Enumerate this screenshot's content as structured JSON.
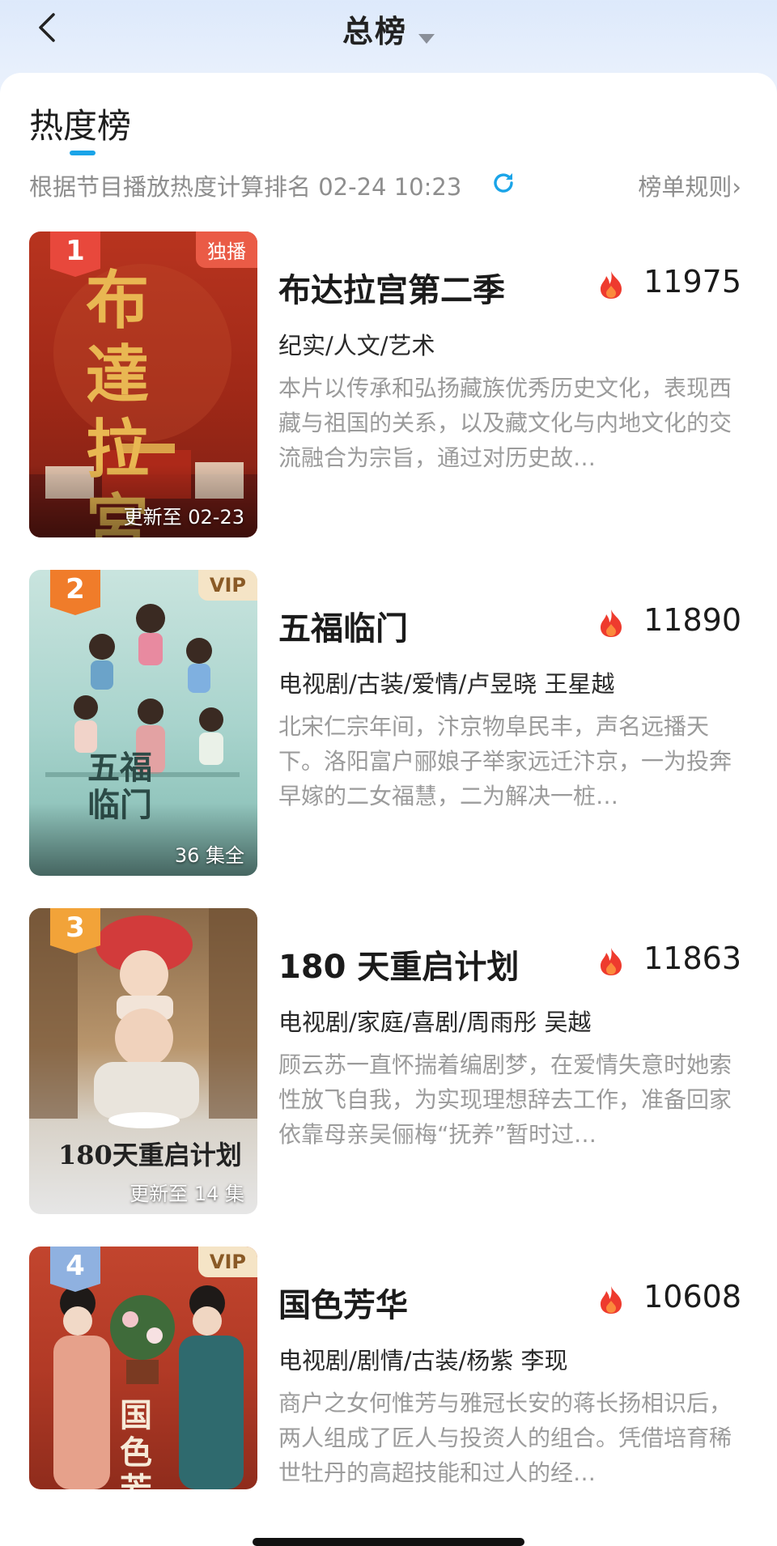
{
  "header": {
    "title": "总榜"
  },
  "section": {
    "title": "热度榜",
    "subtitle": "根据节目播放热度计算排名 02-24 10:23",
    "rules_link": "榜单规则›"
  },
  "items": [
    {
      "rank": "1",
      "corner_tag": "独播",
      "update": "更新至 02-23",
      "title": "布达拉宫第二季",
      "heat": "11975",
      "genres": "纪实/人文/艺术",
      "desc": "本片以传承和弘扬藏族优秀历史文化，表现西藏与祖国的关系，以及藏文化与内地文化的交流融合为宗旨，通过对历史故…",
      "poster_art": "布達拉宮",
      "rank_color": "#e8483c"
    },
    {
      "rank": "2",
      "corner_tag": "VIP",
      "update": "36 集全",
      "title": "五福临门",
      "heat": "11890",
      "genres": "电视剧/古装/爱情/卢昱晓 王星越",
      "desc": "北宋仁宗年间，汴京物阜民丰，声名远播天下。洛阳富户郦娘子举家远迁汴京，一为投奔早嫁的二女福慧，二为解决一桩…",
      "poster_art": "五福临门",
      "rank_color": "#f07c2a"
    },
    {
      "rank": "3",
      "corner_tag": "",
      "update": "更新至 14 集",
      "title": "180 天重启计划",
      "heat": "11863",
      "genres": "电视剧/家庭/喜剧/周雨彤 吴越",
      "desc": "顾云苏一直怀揣着编剧梦，在爱情失意时她索性放飞自我，为实现理想辞去工作，准备回家依靠母亲吴俪梅“抚养”暂时过…",
      "poster_art": "180天重启计划",
      "rank_color": "#f2a339"
    },
    {
      "rank": "4",
      "corner_tag": "VIP",
      "update": "",
      "title": "国色芳华",
      "heat": "10608",
      "genres": "电视剧/剧情/古装/杨紫 李现",
      "desc": "商户之女何惟芳与雅冠长安的蒋长扬相识后，两人组成了匠人与投资人的组合。凭借培育稀世牡丹的高超技能和过人的经…",
      "poster_art": "国色芳华",
      "rank_color": "#8fb1e0"
    }
  ],
  "colors": {
    "accent": "#1aa4e8",
    "flame": "#ee3b2e"
  }
}
